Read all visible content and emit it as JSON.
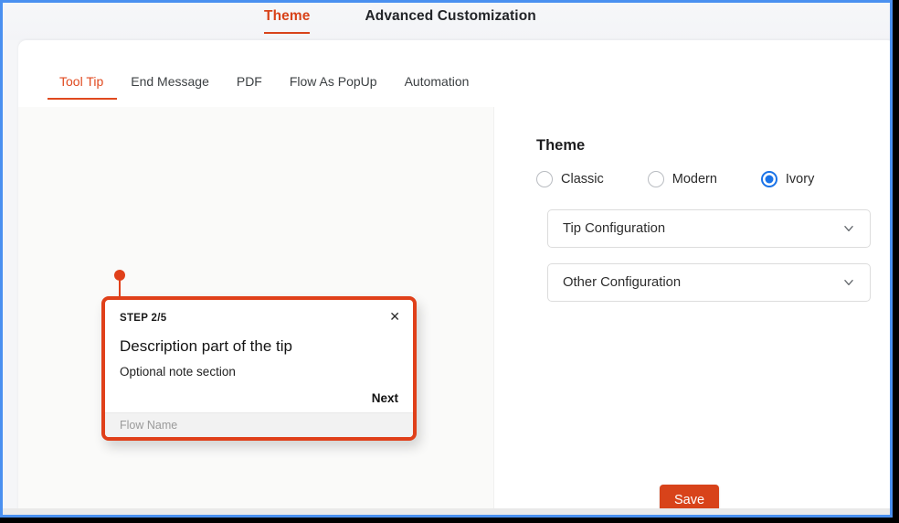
{
  "header": {
    "primary_tabs": [
      {
        "label": "Theme",
        "active": true
      },
      {
        "label": "Advanced Customization",
        "active": false
      }
    ]
  },
  "secondary_tabs": [
    {
      "label": "Tool Tip",
      "active": true
    },
    {
      "label": "End Message",
      "active": false
    },
    {
      "label": "PDF",
      "active": false
    },
    {
      "label": "Flow As PopUp",
      "active": false
    },
    {
      "label": "Automation",
      "active": false
    }
  ],
  "preview": {
    "tooltip": {
      "step_label": "STEP 2/5",
      "close_icon": "close-icon",
      "title": "Description part of the tip",
      "note": "Optional note section",
      "next_label": "Next",
      "flow_name": "Flow Name",
      "border_color": "#e0401a",
      "pin_color": "#e0401a"
    }
  },
  "settings": {
    "heading": "Theme",
    "theme_options": [
      {
        "label": "Classic",
        "selected": false
      },
      {
        "label": "Modern",
        "selected": false
      },
      {
        "label": "Ivory",
        "selected": true
      }
    ],
    "selected_theme": "Ivory",
    "radio_accent_color": "#1a73e8",
    "accordions": [
      {
        "label": "Tip Configuration",
        "icon": "chevron-down-icon",
        "expanded": false
      },
      {
        "label": "Other Configuration",
        "icon": "chevron-down-icon",
        "expanded": false
      }
    ]
  },
  "footer": {
    "save_label": "Save",
    "save_color": "#d8431a"
  }
}
